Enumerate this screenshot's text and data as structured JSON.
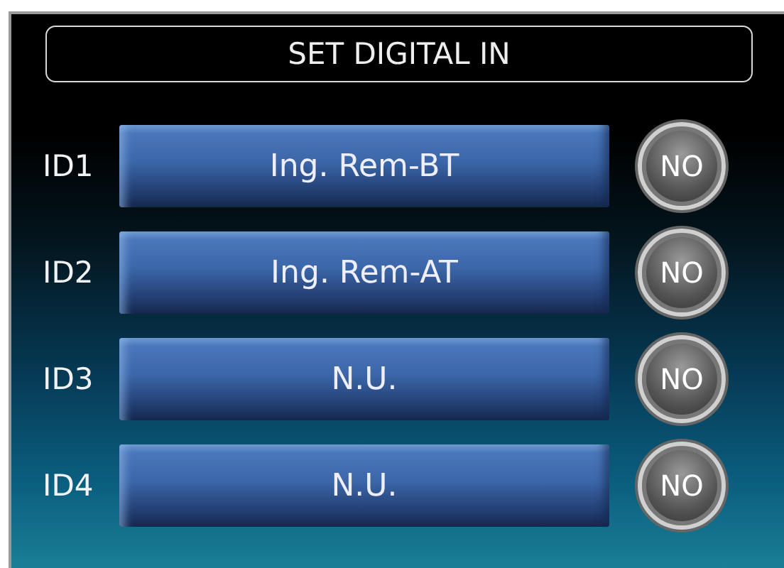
{
  "title": "SET DIGITAL IN",
  "inputs": [
    {
      "label": "ID1",
      "function": "Ing. Rem-BT",
      "mode": "NO"
    },
    {
      "label": "ID2",
      "function": "Ing. Rem-AT",
      "mode": "NO"
    },
    {
      "label": "ID3",
      "function": "N.U.",
      "mode": "NO"
    },
    {
      "label": "ID4",
      "function": "N.U.",
      "mode": "NO"
    }
  ]
}
